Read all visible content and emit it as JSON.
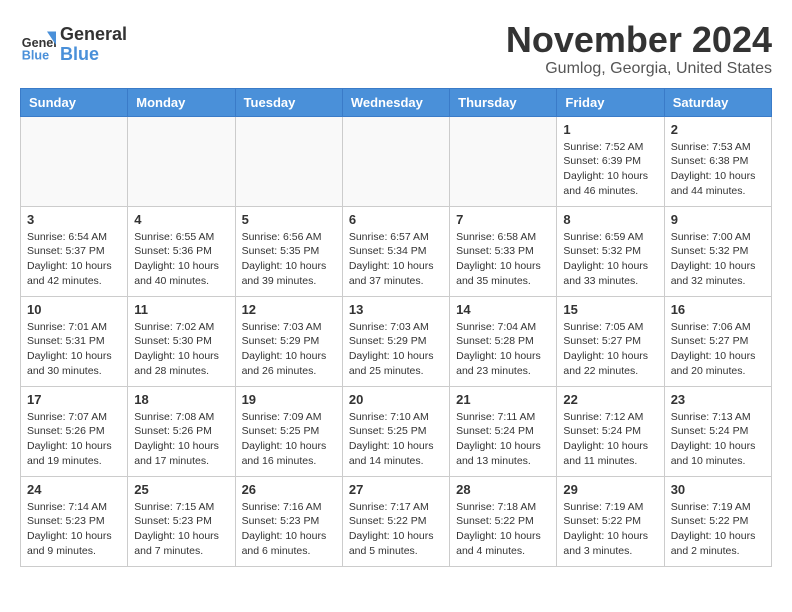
{
  "header": {
    "logo_general": "General",
    "logo_blue": "Blue",
    "month_title": "November 2024",
    "location": "Gumlog, Georgia, United States"
  },
  "days_of_week": [
    "Sunday",
    "Monday",
    "Tuesday",
    "Wednesday",
    "Thursday",
    "Friday",
    "Saturday"
  ],
  "weeks": [
    [
      {
        "day": "",
        "info": ""
      },
      {
        "day": "",
        "info": ""
      },
      {
        "day": "",
        "info": ""
      },
      {
        "day": "",
        "info": ""
      },
      {
        "day": "",
        "info": ""
      },
      {
        "day": "1",
        "info": "Sunrise: 7:52 AM\nSunset: 6:39 PM\nDaylight: 10 hours and 46 minutes."
      },
      {
        "day": "2",
        "info": "Sunrise: 7:53 AM\nSunset: 6:38 PM\nDaylight: 10 hours and 44 minutes."
      }
    ],
    [
      {
        "day": "3",
        "info": "Sunrise: 6:54 AM\nSunset: 5:37 PM\nDaylight: 10 hours and 42 minutes."
      },
      {
        "day": "4",
        "info": "Sunrise: 6:55 AM\nSunset: 5:36 PM\nDaylight: 10 hours and 40 minutes."
      },
      {
        "day": "5",
        "info": "Sunrise: 6:56 AM\nSunset: 5:35 PM\nDaylight: 10 hours and 39 minutes."
      },
      {
        "day": "6",
        "info": "Sunrise: 6:57 AM\nSunset: 5:34 PM\nDaylight: 10 hours and 37 minutes."
      },
      {
        "day": "7",
        "info": "Sunrise: 6:58 AM\nSunset: 5:33 PM\nDaylight: 10 hours and 35 minutes."
      },
      {
        "day": "8",
        "info": "Sunrise: 6:59 AM\nSunset: 5:32 PM\nDaylight: 10 hours and 33 minutes."
      },
      {
        "day": "9",
        "info": "Sunrise: 7:00 AM\nSunset: 5:32 PM\nDaylight: 10 hours and 32 minutes."
      }
    ],
    [
      {
        "day": "10",
        "info": "Sunrise: 7:01 AM\nSunset: 5:31 PM\nDaylight: 10 hours and 30 minutes."
      },
      {
        "day": "11",
        "info": "Sunrise: 7:02 AM\nSunset: 5:30 PM\nDaylight: 10 hours and 28 minutes."
      },
      {
        "day": "12",
        "info": "Sunrise: 7:03 AM\nSunset: 5:29 PM\nDaylight: 10 hours and 26 minutes."
      },
      {
        "day": "13",
        "info": "Sunrise: 7:03 AM\nSunset: 5:29 PM\nDaylight: 10 hours and 25 minutes."
      },
      {
        "day": "14",
        "info": "Sunrise: 7:04 AM\nSunset: 5:28 PM\nDaylight: 10 hours and 23 minutes."
      },
      {
        "day": "15",
        "info": "Sunrise: 7:05 AM\nSunset: 5:27 PM\nDaylight: 10 hours and 22 minutes."
      },
      {
        "day": "16",
        "info": "Sunrise: 7:06 AM\nSunset: 5:27 PM\nDaylight: 10 hours and 20 minutes."
      }
    ],
    [
      {
        "day": "17",
        "info": "Sunrise: 7:07 AM\nSunset: 5:26 PM\nDaylight: 10 hours and 19 minutes."
      },
      {
        "day": "18",
        "info": "Sunrise: 7:08 AM\nSunset: 5:26 PM\nDaylight: 10 hours and 17 minutes."
      },
      {
        "day": "19",
        "info": "Sunrise: 7:09 AM\nSunset: 5:25 PM\nDaylight: 10 hours and 16 minutes."
      },
      {
        "day": "20",
        "info": "Sunrise: 7:10 AM\nSunset: 5:25 PM\nDaylight: 10 hours and 14 minutes."
      },
      {
        "day": "21",
        "info": "Sunrise: 7:11 AM\nSunset: 5:24 PM\nDaylight: 10 hours and 13 minutes."
      },
      {
        "day": "22",
        "info": "Sunrise: 7:12 AM\nSunset: 5:24 PM\nDaylight: 10 hours and 11 minutes."
      },
      {
        "day": "23",
        "info": "Sunrise: 7:13 AM\nSunset: 5:24 PM\nDaylight: 10 hours and 10 minutes."
      }
    ],
    [
      {
        "day": "24",
        "info": "Sunrise: 7:14 AM\nSunset: 5:23 PM\nDaylight: 10 hours and 9 minutes."
      },
      {
        "day": "25",
        "info": "Sunrise: 7:15 AM\nSunset: 5:23 PM\nDaylight: 10 hours and 7 minutes."
      },
      {
        "day": "26",
        "info": "Sunrise: 7:16 AM\nSunset: 5:23 PM\nDaylight: 10 hours and 6 minutes."
      },
      {
        "day": "27",
        "info": "Sunrise: 7:17 AM\nSunset: 5:22 PM\nDaylight: 10 hours and 5 minutes."
      },
      {
        "day": "28",
        "info": "Sunrise: 7:18 AM\nSunset: 5:22 PM\nDaylight: 10 hours and 4 minutes."
      },
      {
        "day": "29",
        "info": "Sunrise: 7:19 AM\nSunset: 5:22 PM\nDaylight: 10 hours and 3 minutes."
      },
      {
        "day": "30",
        "info": "Sunrise: 7:19 AM\nSunset: 5:22 PM\nDaylight: 10 hours and 2 minutes."
      }
    ]
  ]
}
